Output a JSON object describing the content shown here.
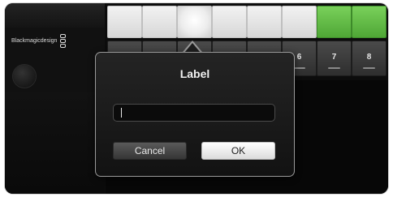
{
  "brand": {
    "name": "Blackmagicdesign",
    "icon": "blackmagic-logo-icon"
  },
  "grid": {
    "top_row": [
      {
        "state": "white"
      },
      {
        "state": "white"
      },
      {
        "state": "highlighted"
      },
      {
        "state": "white"
      },
      {
        "state": "white"
      },
      {
        "state": "white"
      },
      {
        "state": "green"
      },
      {
        "state": "green"
      }
    ],
    "bottom_row_labels": [
      "",
      "",
      "",
      "",
      "",
      "6",
      "7",
      "8"
    ]
  },
  "dialog": {
    "title": "Label",
    "input_value": "",
    "cancel_label": "Cancel",
    "ok_label": "OK"
  },
  "colors": {
    "active_green": "#5fbf43",
    "dialog_border": "#9a9a9a",
    "background": "#0c0c0c"
  }
}
